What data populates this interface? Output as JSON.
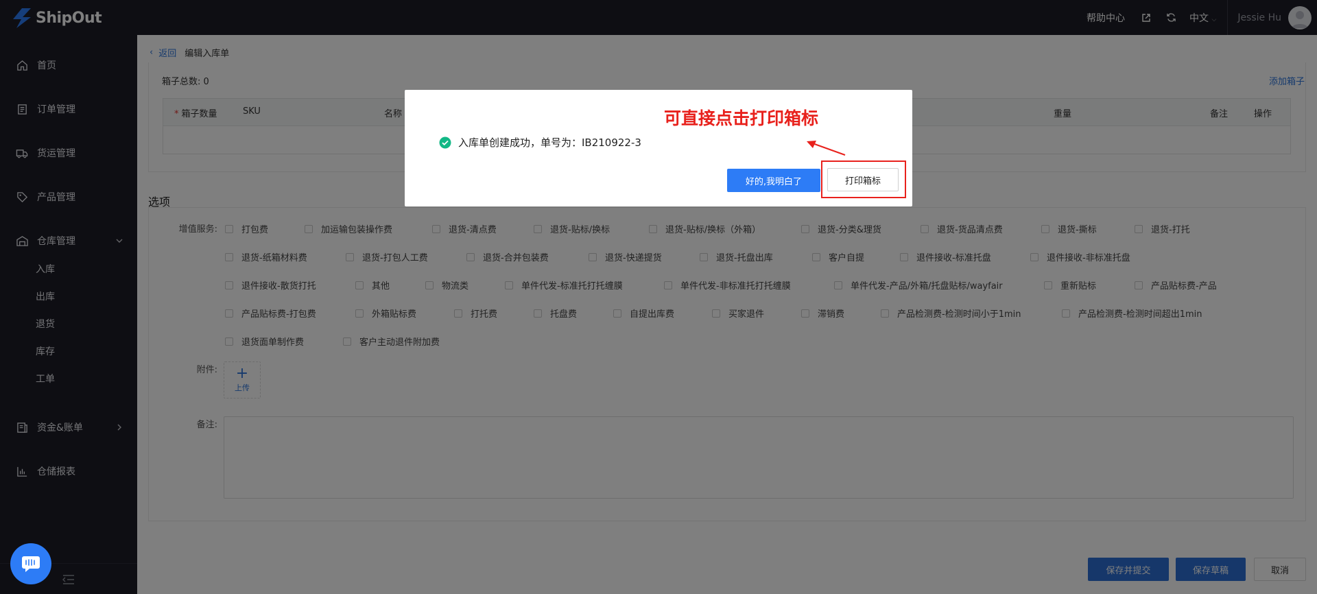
{
  "app": {
    "brand": "ShipOut",
    "help": "帮助中心",
    "language": "中文",
    "user": "Jessie Hu"
  },
  "sidebar": {
    "items": [
      {
        "label": "首页",
        "icon": "home-icon"
      },
      {
        "label": "订单管理",
        "icon": "order-icon"
      },
      {
        "label": "货运管理",
        "icon": "truck-icon"
      },
      {
        "label": "产品管理",
        "icon": "tag-icon"
      },
      {
        "label": "仓库管理",
        "icon": "warehouse-icon"
      },
      {
        "label": "资金&账单",
        "icon": "bill-icon"
      },
      {
        "label": "仓储报表",
        "icon": "chart-icon"
      }
    ],
    "warehouse_sub": [
      "入库",
      "出库",
      "退货",
      "库存",
      "工单"
    ]
  },
  "breadcrumb": {
    "back": "返回",
    "current": "编辑入库单"
  },
  "boxes": {
    "count_label": "箱子总数: 0",
    "add_box": "添加箱子",
    "columns": {
      "qty": "箱子数量",
      "sku": "SKU",
      "name": "名称",
      "weight": "重量",
      "remark": "备注",
      "action": "操作"
    }
  },
  "options": {
    "title": "选项",
    "vas_label": "增值服务:",
    "services": [
      [
        "打包费",
        "加运输包装操作费",
        "退货-清点费",
        "退货-贴标/换标",
        "退货-贴标/换标（外箱）",
        "退货-分类&理货",
        "退货-货品清点费",
        "退货-撕标",
        "退货-打托"
      ],
      [
        "退货-纸箱材料费",
        "退货-打包人工费",
        "退货-合并包装费",
        "退货-快递提货",
        "退货-托盘出库",
        "客户自提",
        "退件接收-标准托盘",
        "退件接收-非标准托盘"
      ],
      [
        "退件接收-散货打托",
        "其他",
        "物流类",
        "单件代发-标准托打托缠膜",
        "单件代发-非标准托打托缠膜",
        "单件代发-产品/外箱/托盘贴标/wayfair",
        "重新贴标",
        "产品贴标费-产品"
      ],
      [
        "产品贴标费-打包费",
        "外箱贴标费",
        "打托费",
        "托盘费",
        "自提出库费",
        "买家退件",
        "滞销费",
        "产品检测费-检测时间小于1min",
        "产品检测费-检测时间超出1min"
      ],
      [
        "退货面单制作费",
        "客户主动退件附加费"
      ]
    ],
    "attachment_label": "附件:",
    "upload_label": "上传",
    "remark_label": "备注:"
  },
  "actions": {
    "save_submit": "保存并提交",
    "save_draft": "保存草稿",
    "cancel": "取消"
  },
  "modal": {
    "message": "入库单创建成功，单号为：IB210922-3",
    "annotation": "可直接点击打印箱标",
    "ok_button": "好的,我明白了",
    "print_button": "打印箱标"
  },
  "colors": {
    "sidebar_bg": "#1c1d26",
    "primary": "#2d7cf6",
    "link": "#2d74da",
    "success": "#12b886",
    "annotation_red": "#e8211c"
  }
}
